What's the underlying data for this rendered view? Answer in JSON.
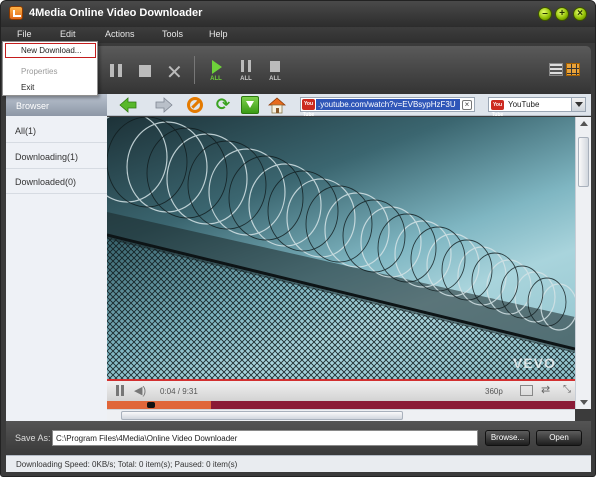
{
  "window": {
    "title": "4Media Online Video Downloader"
  },
  "menubar": {
    "file": "File",
    "edit": "Edit",
    "actions": "Actions",
    "tools": "Tools",
    "help": "Help"
  },
  "file_menu": {
    "new_download": "New Download...",
    "properties": "Properties",
    "exit": "Exit"
  },
  "toolbar": {
    "start_all_label": "ALL",
    "pause_all_label": "ALL",
    "stop_all_label": "ALL"
  },
  "sidebar": {
    "header": "Browser",
    "items": [
      {
        "label": "All(1)"
      },
      {
        "label": "Downloading(1)"
      },
      {
        "label": "Downloaded(0)"
      }
    ]
  },
  "browser": {
    "url_value": ".youtube.com/watch?v=EVBsypHzF3U",
    "url_icon_text": "You Tube",
    "site_icon_text": "You Tube",
    "site_selected": "YouTube"
  },
  "player": {
    "time": "0:04 / 9:31",
    "quality": "360p",
    "watermark": "VEVO",
    "progress_fraction": 0.48
  },
  "save": {
    "label": "Save As:",
    "path": "C:\\Program Files\\4Media\\Online Video Downloader",
    "browse": "Browse...",
    "open": "Open"
  },
  "status": {
    "text": "Downloading Speed: 0KB/s; Total: 0 item(s); Paused: 0 item(s)"
  },
  "colors": {
    "accent_green": "#6ed23a",
    "selection_blue": "#2f56b8",
    "menu_highlight_border": "#c41d1d",
    "player_red": "#d23030"
  }
}
